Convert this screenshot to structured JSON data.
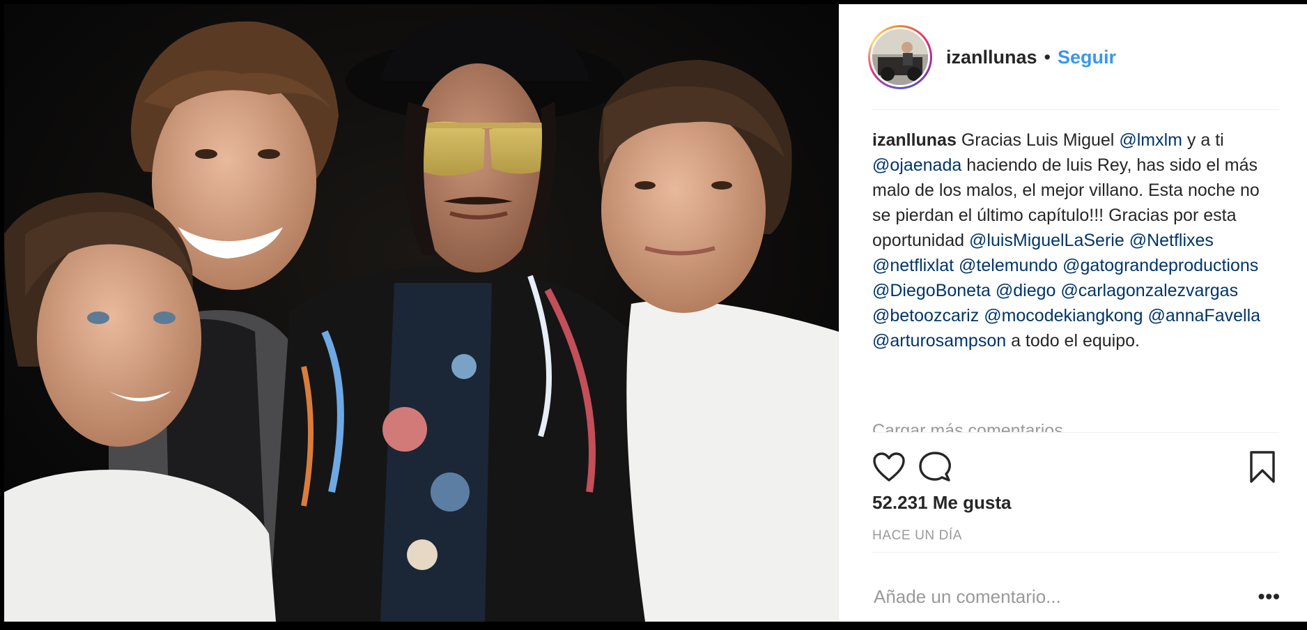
{
  "post": {
    "username": "izanllunas",
    "separator": "•",
    "follow_label": "Seguir",
    "caption": {
      "author": "izanllunas",
      "p1": " Gracias Luis Miguel ",
      "m1": "@lmxlm",
      "p2": " y a ti ",
      "m2": "@ojaenada",
      "p3": " haciendo de luis Rey, has sido el más malo de los malos, el mejor villano. Esta noche no se pierdan el último capítulo!!! Gracias por esta oportunidad ",
      "mentions": [
        "@luisMiguelLaSerie",
        "@Netflixes",
        "@netflixlat",
        "@telemundo",
        "@gatograndeproductions",
        "@DiegoBoneta",
        "@diego",
        "@carlagonzalezvargas",
        "@betoozcariz",
        "@mocodekiangkong",
        "@annaFavella",
        "@arturosampson"
      ],
      "ending": " a todo el equipo."
    },
    "load_more_label": "Cargar más comentarios",
    "likes_label": "52.231 Me gusta",
    "timestamp": "HACE UN DÍA",
    "comment_placeholder": "Añade un comentario...",
    "more_label": "•••",
    "icons": {
      "like": "heart-icon",
      "comment": "comment-icon",
      "save": "bookmark-icon"
    },
    "colors": {
      "follow": "#3897f0",
      "mention": "#003569",
      "muted": "#999999",
      "text": "#262626"
    }
  }
}
